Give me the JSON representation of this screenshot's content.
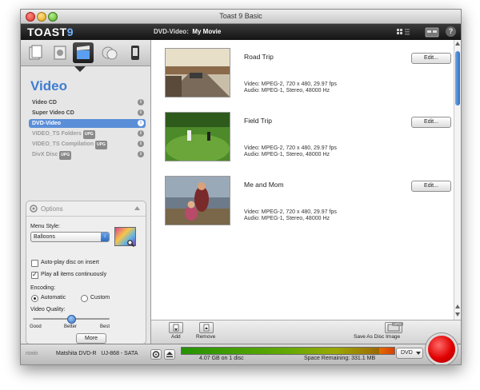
{
  "window": {
    "title": "Toast 9 Basic"
  },
  "header": {
    "logo": "TOAST",
    "logo_version": "9",
    "disc_label": "DVD-Video:",
    "disc_name": "My Movie"
  },
  "sidebar": {
    "category_title": "Video",
    "formats": [
      {
        "label": "Video CD",
        "badge": "",
        "state": "normal"
      },
      {
        "label": "Super Video CD",
        "badge": "",
        "state": "normal"
      },
      {
        "label": "DVD-Video",
        "badge": "",
        "state": "selected"
      },
      {
        "label": "VIDEO_TS Folders",
        "badge": "UPG",
        "state": "dimmed"
      },
      {
        "label": "VIDEO_TS Compilation",
        "badge": "UPG",
        "state": "dimmed"
      },
      {
        "label": "DivX Disc",
        "badge": "UPG",
        "state": "dimmed"
      }
    ]
  },
  "options": {
    "title": "Options",
    "menu_style_label": "Menu Style:",
    "menu_style_value": "Balloons",
    "autoplay_label": "Auto-play disc on insert",
    "autoplay_checked": false,
    "play_all_label": "Play all items continuously",
    "play_all_checked": true,
    "encoding_label": "Encoding:",
    "encoding_options": [
      "Automatic",
      "Custom"
    ],
    "encoding_selected": "Automatic",
    "quality_label": "Video Quality:",
    "quality_ticks": [
      "Good",
      "Better",
      "Best"
    ],
    "quality_level": 0.5,
    "more_button": "More"
  },
  "items": [
    {
      "name": "Road Trip",
      "video": "Video: MPEG-2, 720 x 480, 29.97 fps",
      "audio": "Audio: MPEG-1, Stereo, 48000 Hz",
      "edit": "Edit..."
    },
    {
      "name": "Field Trip",
      "video": "Video: MPEG-2, 720 x 480, 29.97 fps",
      "audio": "Audio: MPEG-1, Stereo, 48000 Hz",
      "edit": "Edit..."
    },
    {
      "name": "Me and Mom",
      "video": "Video: MPEG-2, 720 x 480, 29.97 fps",
      "audio": "Audio: MPEG-1, Stereo, 48000 Hz",
      "edit": "Edit..."
    }
  ],
  "toolbar": {
    "add": "Add",
    "remove": "Remove",
    "save_image": "Save As Disc Image",
    "upg_badge": "UPG"
  },
  "status": {
    "brand": "roxio",
    "drive": "Matshita DVD-R   UJ-868 - SATA",
    "usage": "4.07 GB on 1 disc",
    "space_remaining": "Space Remaining: 331.1 MB",
    "usage_fraction": 0.93,
    "media_type": "DVD"
  },
  "colors": {
    "accent": "#3f7ed0",
    "selection": "#5a8ed8",
    "burn_button": "#e00000",
    "header": "#1e1e1e"
  }
}
